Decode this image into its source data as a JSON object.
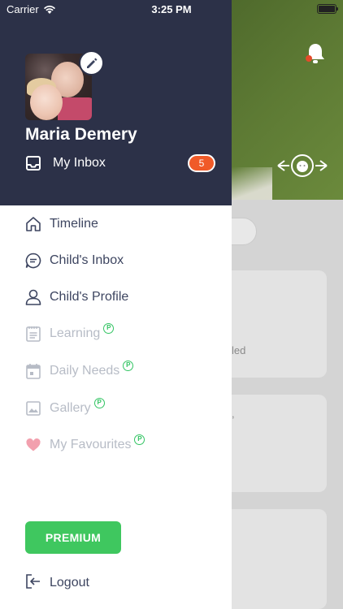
{
  "status_bar": {
    "carrier": "Carrier",
    "time": "3:25 PM"
  },
  "background": {
    "partial_text_1": "led",
    "partial_text_2": ","
  },
  "profile": {
    "name": "Maria Demery",
    "inbox_label": "My Inbox",
    "inbox_count": "5"
  },
  "menu": {
    "items": [
      {
        "label": "Timeline",
        "icon": "home-icon",
        "enabled": true
      },
      {
        "label": "Child's Inbox",
        "icon": "chat-bubble-icon",
        "enabled": true
      },
      {
        "label": "Child's Profile",
        "icon": "person-icon",
        "enabled": true
      },
      {
        "label": "Learning",
        "icon": "notepad-icon",
        "enabled": false,
        "premium": true
      },
      {
        "label": "Daily Needs",
        "icon": "calendar-icon",
        "enabled": false,
        "premium": true
      },
      {
        "label": "Gallery",
        "icon": "image-icon",
        "enabled": false,
        "premium": true
      },
      {
        "label": "My Favourites",
        "icon": "heart-icon",
        "enabled": false,
        "premium": true
      }
    ],
    "premium_badge": "P",
    "premium_button": "PREMIUM",
    "logout": "Logout"
  },
  "colors": {
    "header": "#2c3148",
    "accent_green": "#3fc75f",
    "badge_orange": "#f05a28",
    "text": "#3d4560",
    "disabled": "#b7bcc6"
  }
}
